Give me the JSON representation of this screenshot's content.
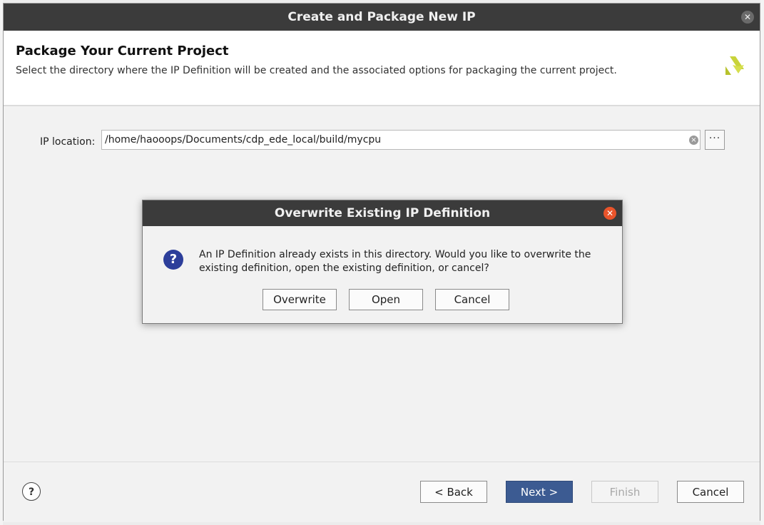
{
  "window": {
    "title": "Create and Package New IP",
    "close_glyph": "✕"
  },
  "header": {
    "title": "Package Your Current Project",
    "subtitle": "Select the directory where the IP Definition will be created and the associated options for packaging the current project."
  },
  "form": {
    "ip_location_label": "IP location:",
    "ip_location_value": "/home/haooops/Documents/cdp_ede_local/build/mycpu",
    "browse_label": "···"
  },
  "footer": {
    "help_label": "?",
    "back_label": "< Back",
    "next_label": "Next >",
    "finish_label": "Finish",
    "cancel_label": "Cancel"
  },
  "dialog": {
    "title": "Overwrite Existing IP Definition",
    "close_glyph": "✕",
    "question_glyph": "?",
    "message": "An IP Definition already exists in this directory. Would you like to overwrite the existing definition, open the existing definition, or cancel?",
    "overwrite_label": "Overwrite",
    "open_label": "Open",
    "cancel_label": "Cancel"
  },
  "colors": {
    "titlebar": "#3b3b3b",
    "primary_button": "#3c5b92",
    "dialog_close": "#e9542b",
    "question_icon": "#2c3e9a"
  }
}
